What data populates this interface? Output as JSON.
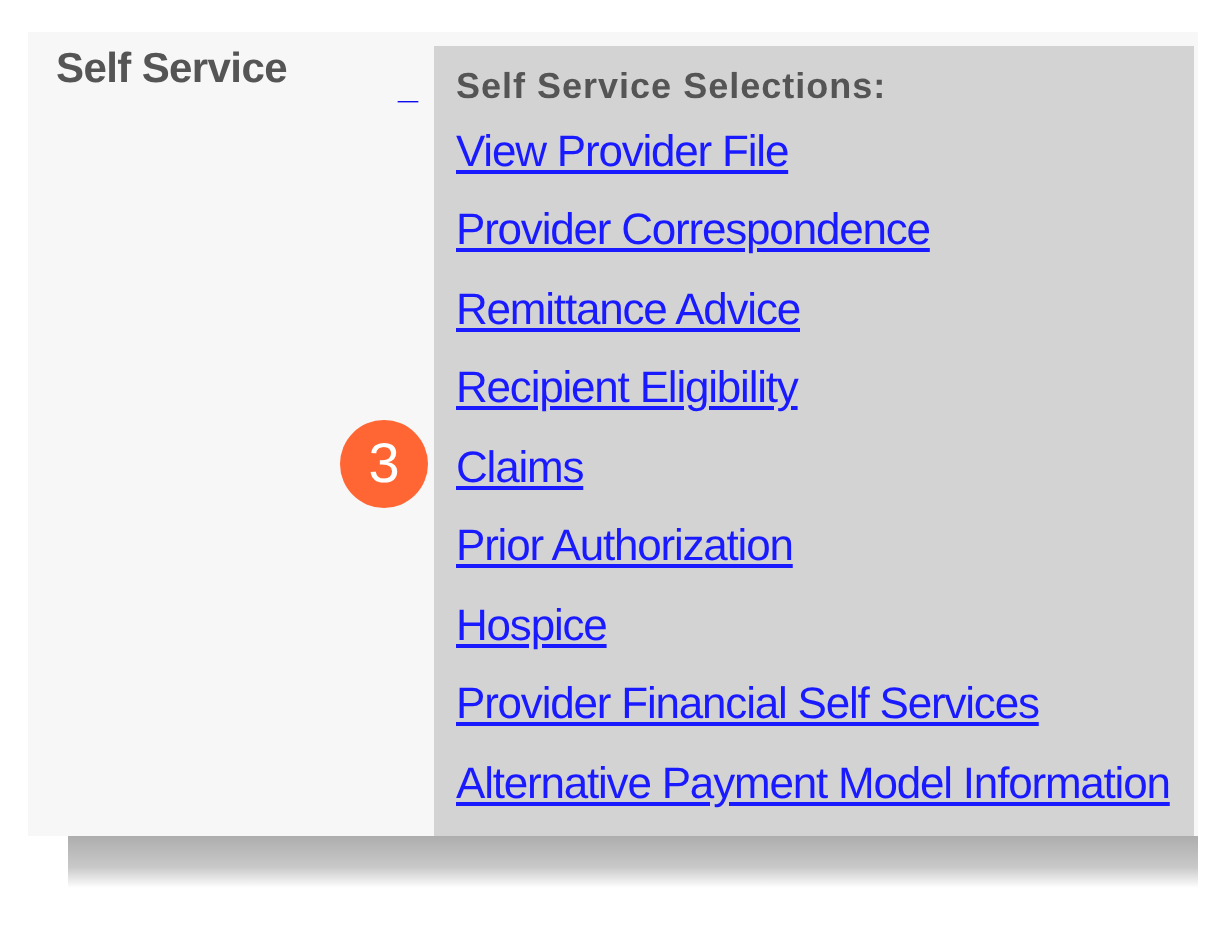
{
  "section": {
    "title": "Self Service",
    "collapse_link": "_"
  },
  "selections": {
    "heading": "Self Service Selections:",
    "links": [
      {
        "label": "View Provider File"
      },
      {
        "label": "Provider Correspondence"
      },
      {
        "label": "Remittance Advice"
      },
      {
        "label": "Recipient Eligibility"
      },
      {
        "label": "Claims",
        "badge": "3"
      },
      {
        "label": "Prior Authorization"
      },
      {
        "label": "Hospice"
      },
      {
        "label": "Provider Financial Self Services"
      },
      {
        "label": "Alternative Payment Model Information"
      }
    ]
  }
}
